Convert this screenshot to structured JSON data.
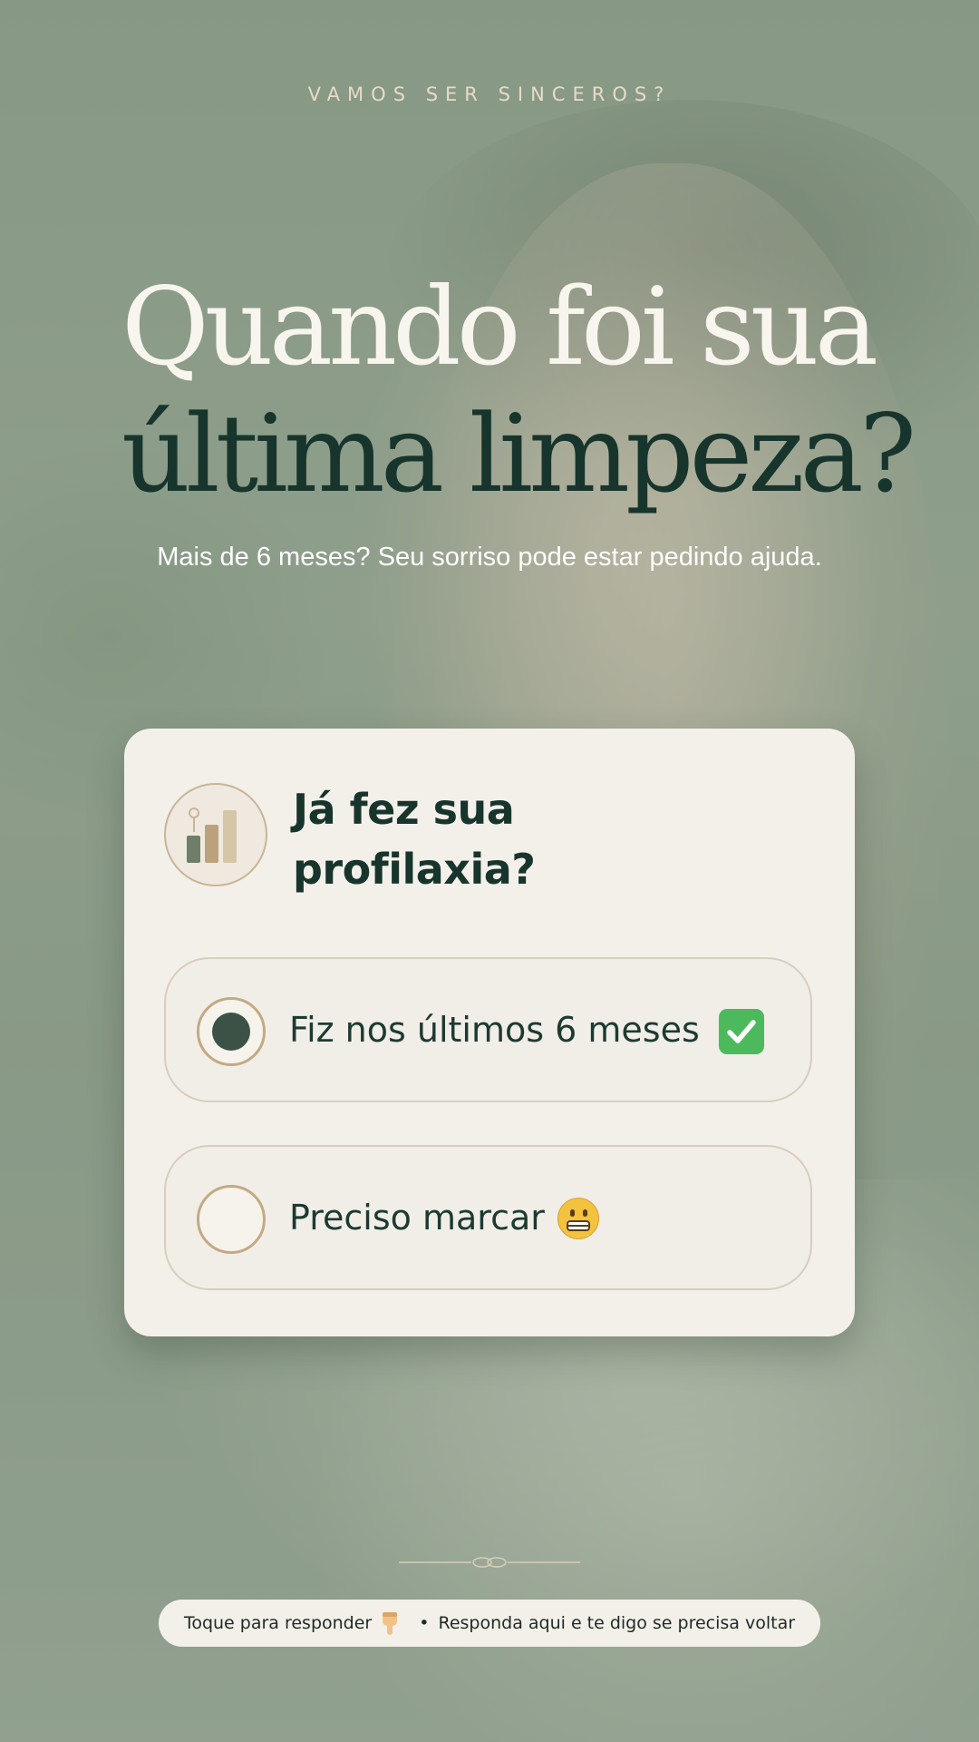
{
  "eyebrow": "VAMOS SER SINCEROS?",
  "headline": {
    "line1": "Quando foi sua",
    "line2": "última limpeza?"
  },
  "subtitle": "Mais de 6 meses? Seu sorriso pode estar pedindo ajuda.",
  "poll": {
    "icon": "bar-chart-icon",
    "question_line1": "Já fez sua",
    "question_line2": "profilaxia?",
    "options": [
      {
        "label": "Fiz nos últimos 6 meses",
        "icon": "check-mark-icon",
        "selected": true
      },
      {
        "label": "Preciso marcar",
        "icon": "grimacing-face-icon",
        "selected": false
      }
    ]
  },
  "footer": {
    "tap_text": "Toque para responder",
    "tap_icon": "pointing-down-hand-icon",
    "separator": "•",
    "cta_text": "Responda aqui e te digo se precisa voltar"
  },
  "colors": {
    "background": "#8e9e8c",
    "card": "#f3f0ea",
    "dark_green": "#17352c",
    "gold_accent": "#c3aa82",
    "check_green": "#4cba5c"
  }
}
